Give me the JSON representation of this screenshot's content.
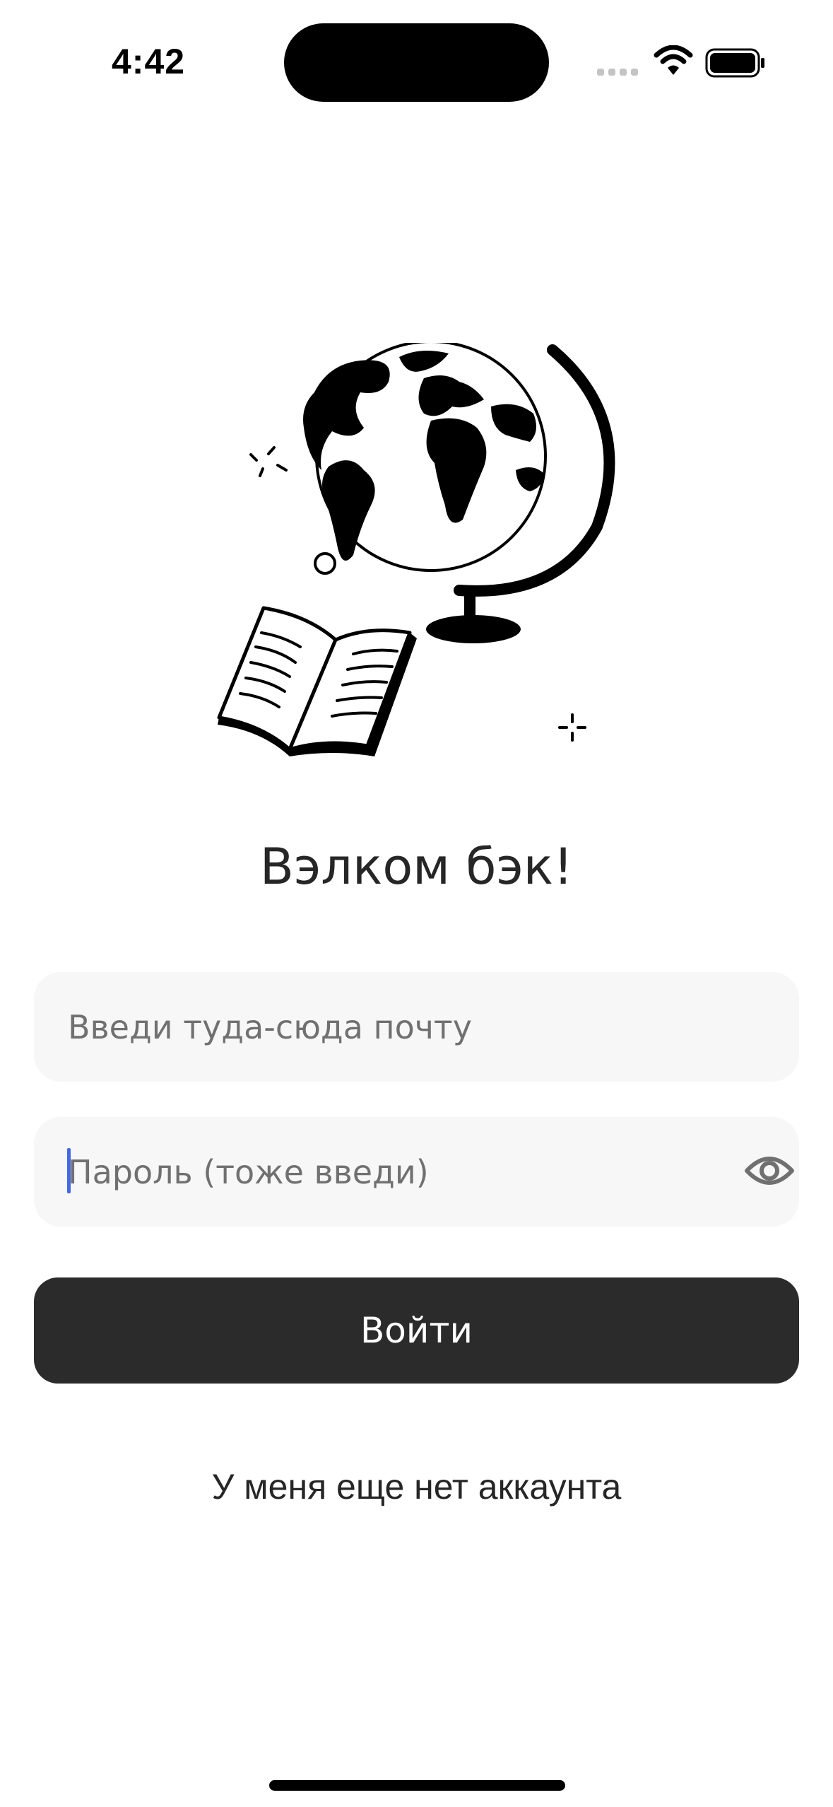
{
  "status_bar": {
    "time": "4:42"
  },
  "icons": {
    "signal": "cellular-signal-icon",
    "wifi": "wifi-icon",
    "battery": "battery-icon",
    "eye": "eye-icon",
    "illustration": "globe-and-book-illustration"
  },
  "login": {
    "title": "Вэлком бэк!",
    "email_placeholder": "Введи туда-сюда почту",
    "password_placeholder": "Пароль (тоже введи)",
    "submit_label": "Войти",
    "signup_link": "У меня еще нет аккаунта"
  },
  "colors": {
    "button_bg": "#2b2b2b",
    "field_bg": "#f7f7f7",
    "caret": "#4169e1"
  }
}
